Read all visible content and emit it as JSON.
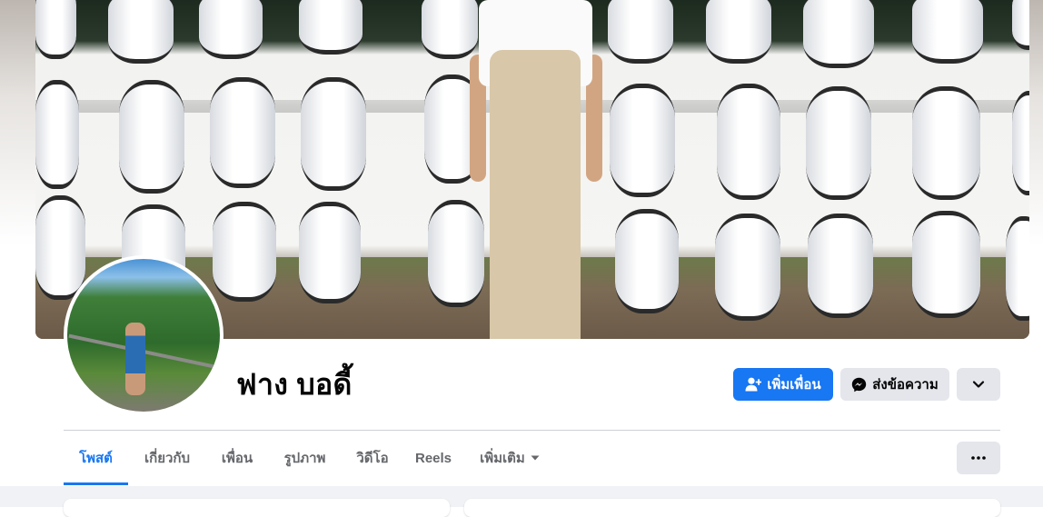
{
  "profile": {
    "name": "ฟาง บอดี้"
  },
  "actions": {
    "add_friend_label": "เพิ่มเพื่อน",
    "message_label": "ส่งข้อความ"
  },
  "tabs": [
    {
      "label": "โพสต์",
      "active": true
    },
    {
      "label": "เกี่ยวกับ",
      "active": false
    },
    {
      "label": "เพื่อน",
      "active": false
    },
    {
      "label": "รูปภาพ",
      "active": false
    },
    {
      "label": "วิดีโอ",
      "active": false
    },
    {
      "label": "Reels",
      "active": false
    },
    {
      "label": "เพิ่มเติม",
      "active": false
    }
  ],
  "icons": {
    "add_friend": "add-friend-icon",
    "messenger": "messenger-icon",
    "chevron": "chevron-down-icon",
    "more": "more-dots-icon",
    "caret": "caret-down-icon"
  },
  "colors": {
    "accent": "#1877f2",
    "button_gray": "#e4e6eb",
    "tab_text": "#65676b"
  }
}
